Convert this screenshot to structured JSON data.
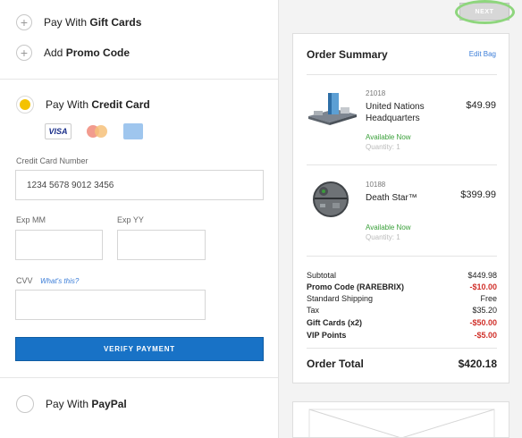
{
  "payment": {
    "gift_cards": {
      "prefix": "Pay With ",
      "bold": "Gift Cards"
    },
    "promo_code": {
      "prefix": "Add ",
      "bold": "Promo Code"
    },
    "credit_card": {
      "prefix": "Pay With ",
      "bold": "Credit Card"
    },
    "card_brands": [
      "VISA",
      "Mastercard",
      "Amex"
    ],
    "card_number_label": "Credit Card Number",
    "card_number_value": "1234 5678 9012 3456",
    "exp_mm_label": "Exp MM",
    "exp_yy_label": "Exp YY",
    "cvv_label": "CVV",
    "whats_this": "What's this?",
    "verify_button": "VERIFY PAYMENT",
    "paypal": {
      "prefix": "Pay With ",
      "bold": "PayPal"
    }
  },
  "header": {
    "next_button": "NEXT"
  },
  "summary": {
    "title": "Order Summary",
    "edit_link": "Edit Bag",
    "items": [
      {
        "number": "21018",
        "name": "United Nations Headquarters",
        "price": "$49.99",
        "availability": "Available Now",
        "quantity": "Quantity: 1"
      },
      {
        "number": "10188",
        "name": "Death Star™",
        "price": "$399.99",
        "availability": "Available Now",
        "quantity": "Quantity: 1"
      }
    ],
    "totals": [
      {
        "label": "Subtotal",
        "value": "$449.98"
      },
      {
        "label": "Promo Code (RAREBRIX)",
        "value": "-$10.00"
      },
      {
        "label": "Standard Shipping",
        "value": "Free"
      },
      {
        "label": "Tax",
        "value": "$35.20"
      },
      {
        "label": "Gift Cards (x2)",
        "value": "-$50.00"
      },
      {
        "label": "VIP Points",
        "value": "-$5.00"
      }
    ],
    "total_label": "Order Total",
    "total_value": "$420.18"
  },
  "colors": {
    "accent_blue": "#1872c6",
    "radio_yellow": "#f4c200",
    "available_green": "#3aa03a",
    "discount_red": "#d0302a",
    "highlight_ring": "#8ed67d"
  }
}
